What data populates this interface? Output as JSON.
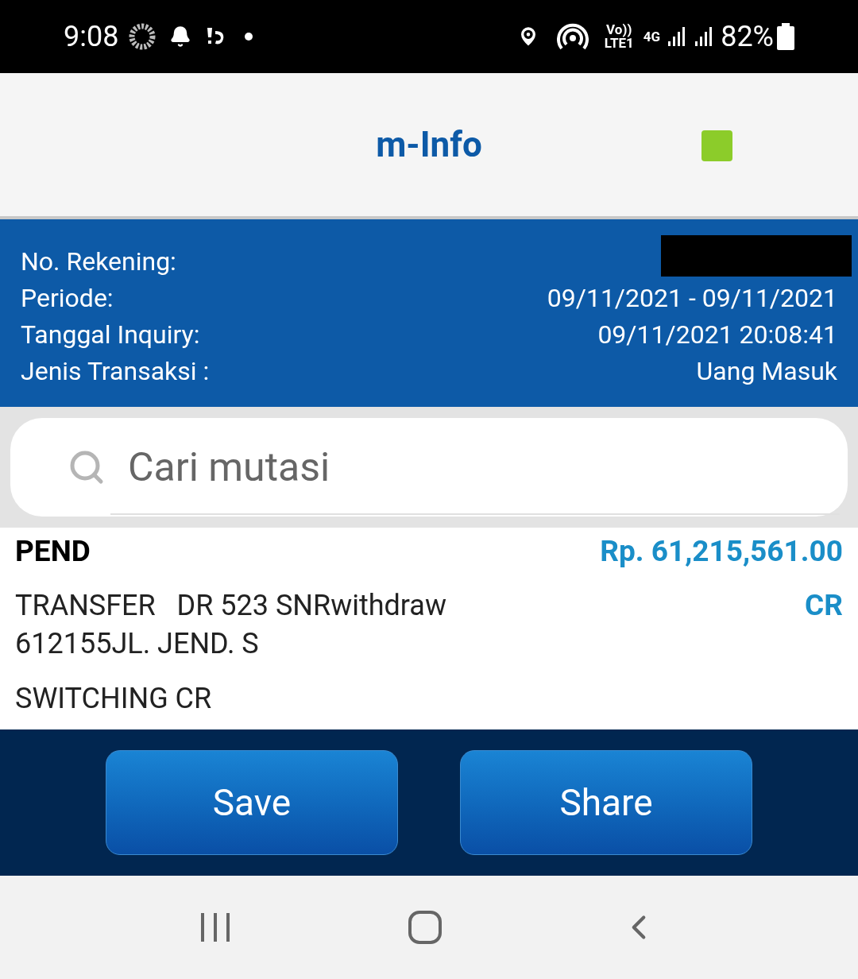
{
  "status_bar": {
    "time": "9:08",
    "volte": "Vo))",
    "lte": "LTE1",
    "network": "4G",
    "battery": "82%"
  },
  "header": {
    "title": "m-Info"
  },
  "info": [
    {
      "label": "No. Rekening:",
      "redacted": true
    },
    {
      "label": "Periode:",
      "value": "09/11/2021 - 09/11/2021"
    },
    {
      "label": "Tanggal Inquiry:",
      "value": "09/11/2021 20:08:41"
    },
    {
      "label": "Jenis Transaksi :",
      "value": "Uang Masuk"
    }
  ],
  "search": {
    "placeholder": "Cari mutasi"
  },
  "transactions": [
    {
      "status": "PEND",
      "amount": "Rp. 61,215,561.00",
      "description": "TRANSFER   DR 523 SNRwithdraw 612155JL. JEND. S",
      "type": "CR",
      "note": "SWITCHING CR"
    }
  ],
  "buttons": [
    "Save",
    "Share"
  ]
}
